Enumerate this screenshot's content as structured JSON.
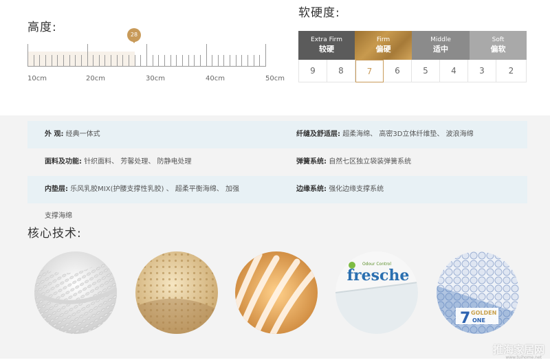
{
  "height_section": {
    "title": "高度:",
    "marker_value": "28",
    "ruler_labels": [
      "10cm",
      "20cm",
      "30cm",
      "40cm",
      "50cm"
    ],
    "current_height_cm": 28
  },
  "firmness_section": {
    "title": "软硬度:",
    "levels": [
      {
        "en": "Extra Firm",
        "zh": "较硬",
        "color": "#5b5b5b"
      },
      {
        "en": "Firm",
        "zh": "偏硬",
        "color": "#b8893e"
      },
      {
        "en": "Middle",
        "zh": "适中",
        "color": "#8b8b8b"
      },
      {
        "en": "Soft",
        "zh": "偏软",
        "color": "#a9a9a9"
      }
    ],
    "scale": [
      "9",
      "8",
      "7",
      "6",
      "5",
      "4",
      "3",
      "2"
    ],
    "selected": "7"
  },
  "specs": [
    {
      "label": "外 观:",
      "value": "经典一体式"
    },
    {
      "label": "纤缝及舒适层:",
      "value": "超柔海绵、 高密3D立体纤维垫、 波浪海绵"
    },
    {
      "label": "面料及功能:",
      "value": "针织面料、 芳馨处理、 防静电处理"
    },
    {
      "label": "弹簧系统:",
      "value": "自然七区独立袋装弹簧系统"
    },
    {
      "label": "内垫层:",
      "value": "乐风乳胶MIX(护腰支撑性乳胶) 、 超柔平衡海绵、 加强"
    },
    {
      "label": "边缘系统:",
      "value": "强化边缘支撑系统"
    },
    {
      "label": "",
      "value": "支撑海绵"
    }
  ],
  "core_tech": {
    "title": "核心技术:",
    "items": [
      {
        "name": "knit-fabric-image"
      },
      {
        "name": "latex-image"
      },
      {
        "name": "fiber-image"
      },
      {
        "name": "fresche-image",
        "text": "fresche",
        "subtext": "Odour Control"
      },
      {
        "name": "zone-spring-image",
        "text_num": "7",
        "text_a": "GOLDEN",
        "text_b": "ONE"
      }
    ]
  },
  "watermark": {
    "text": "推海家居网",
    "url": "www.tuihome.net"
  }
}
